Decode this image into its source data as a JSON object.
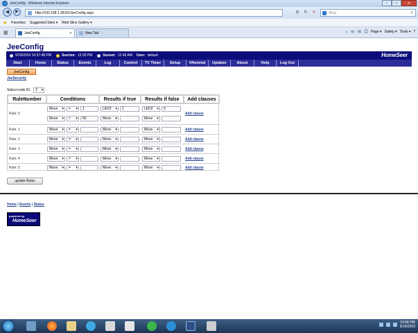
{
  "window": {
    "title": "JeeConfig - Windows Internet Explorer",
    "min": "–",
    "max": "□",
    "close": "✕"
  },
  "address": {
    "url": "http://192.168.1.38:81/JeeConfig.aspx",
    "search_placeholder": "Bing"
  },
  "favorites": {
    "label": "Favorites",
    "items": [
      "Suggested Sites ▾",
      "Web Slice Gallery ▾"
    ]
  },
  "tabs": [
    {
      "label": "JeeConfig"
    },
    {
      "label": "New Tab"
    }
  ],
  "command_bar": {
    "page": "Page ▾",
    "safety": "Safety ▾",
    "tools": "Tools ▾",
    "help": "?"
  },
  "app": {
    "title": "JeeConfig",
    "datetime": "9/18/2010 10:57:48 PM",
    "sunrise_label": "Sunrise:",
    "sunrise": "12:26 PM",
    "sunset_label": "Sunset:",
    "sunset": "12:49 AM",
    "user_label": "User:",
    "user": "default",
    "logo": "HomeSeer",
    "menu": [
      "Start",
      "Home",
      "Status",
      "Events",
      "Log",
      "Control",
      "TV Timer",
      "Setup",
      "VRemind",
      "Updater",
      "About",
      "Help",
      "Log Out"
    ],
    "jeeconfig_button": "JeeConfig",
    "jeesecurity_link": "JeeSecurity",
    "node_label": "Select node ID:",
    "node_value": "2",
    "headers": [
      "RuleNumber",
      "Conditions",
      "Results if true",
      "Results if false",
      "Add clauses"
    ],
    "rule0": {
      "label": "Rule: 0",
      "cond1": {
        "type": "Move",
        "op": "=",
        "value": "1"
      },
      "cond2": {
        "type": "Move",
        "op": "<",
        "value": "50"
      },
      "true1": {
        "type": "LED2",
        "value": "1"
      },
      "true2": {
        "type": "Move"
      },
      "false1": {
        "type": "LED2",
        "value": "0"
      },
      "false2": {
        "type": "Move"
      },
      "add": "Add clause"
    },
    "rules": [
      {
        "label": "Rule: 1",
        "type": "Move",
        "op": "=",
        "t": "Move",
        "f": "Move",
        "add": "Add clause"
      },
      {
        "label": "Rule: 2",
        "type": "Move",
        "op": "=",
        "t": "Move",
        "f": "Move",
        "add": "Add clause"
      },
      {
        "label": "Rule: 3",
        "type": "Move",
        "op": "=",
        "t": "Move",
        "f": "Move",
        "add": "Add clause"
      },
      {
        "label": "Rule: 4",
        "type": "Move",
        "op": "=",
        "t": "Move",
        "f": "Move",
        "add": "Add clause"
      },
      {
        "label": "Rule: 5",
        "type": "Move",
        "op": "=",
        "t": "Move",
        "f": "Move",
        "add": "Add clause"
      }
    ],
    "update_button": "update Rules",
    "footer_links": [
      "Home",
      "Events",
      "Status"
    ],
    "powered_by": "powered by",
    "powered_logo": "HomeSeer"
  },
  "taskbar": {
    "time": "10:58 PM",
    "date": "9/18/2010"
  }
}
